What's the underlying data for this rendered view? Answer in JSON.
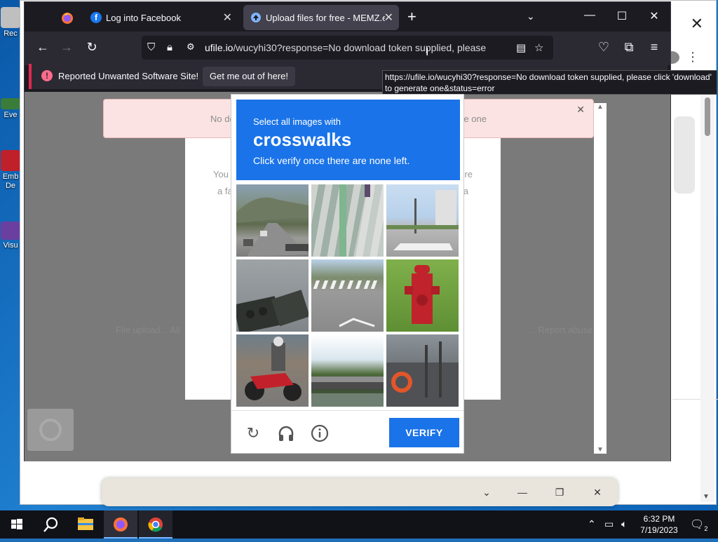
{
  "desktop": {
    "icons": [
      {
        "label": "Rec",
        "color": "#bfbfbf"
      },
      {
        "label": "Eve",
        "color": "#3a7d3a"
      },
      {
        "label": "Emb",
        "color": "#c0202a"
      },
      {
        "label": "De",
        "color": "#c0202a"
      },
      {
        "label": "Visu",
        "color": "#6b3fa0"
      }
    ]
  },
  "firefox": {
    "tabs": [
      {
        "title": "Log into Facebook",
        "favicon": "facebook-icon"
      },
      {
        "title": "Upload files for free - MEMZ.ex",
        "favicon": "upload-icon"
      }
    ],
    "url": {
      "domain": "ufile.io",
      "path": "/wucyhi30?response=No download token supplied, please"
    },
    "warning": {
      "text": "Reported Unwanted Software Site!",
      "button": "Get me out of here!"
    },
    "tooltip_line1": "https://ufile.io/wucyhi30?response=No download token supplied, please click 'download'",
    "tooltip_line2": "to generate one&status=error"
  },
  "page": {
    "alert_left": "No do",
    "alert_right": "e one",
    "card_left_1": "You",
    "card_left_2": "a fa",
    "card_right_1": "re",
    "card_right_2": "a",
    "faint_left": "File upload... All",
    "faint_right": "... Report abuse"
  },
  "captcha": {
    "instruction": "Select all images with",
    "target": "crosswalks",
    "hint": "Click verify once there are none left.",
    "verify_label": "VERIFY",
    "tiles": [
      "highway-with-cars",
      "crosswalk-stripes",
      "parking-lot-crosswalk",
      "traffic-light",
      "intersection-crosswalk",
      "fire-hydrant",
      "motorcycle-rider",
      "bridge-over-river",
      "boat-with-lifebuoy"
    ]
  },
  "background_window": {
    "minibar_icons": [
      "chevron-down-icon",
      "minimize-icon",
      "restore-icon",
      "close-icon"
    ]
  },
  "taskbar": {
    "time": "6:32 PM",
    "date": "7/19/2023",
    "notifications": "2"
  },
  "colors": {
    "captcha_blue": "#1a73e8",
    "firefox_dark": "#1c1b22",
    "warning_red": "#e22850"
  }
}
